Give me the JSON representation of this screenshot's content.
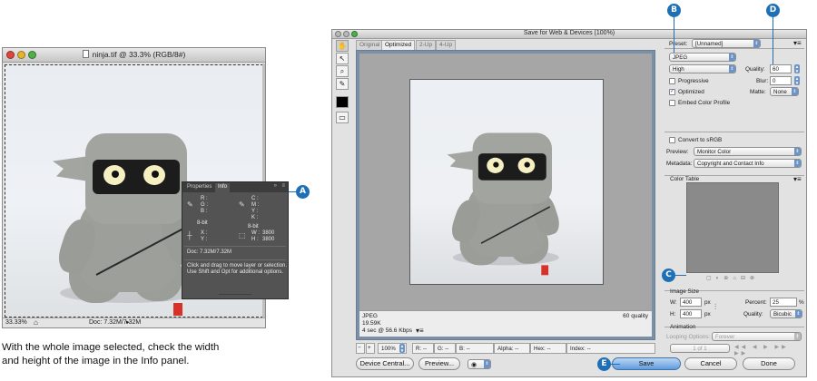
{
  "doc_window": {
    "title": "ninja.tif @ 33.3% (RGB/8#)",
    "zoom": "33.33%",
    "doc_size": "Doc: 7.32M/7.32M"
  },
  "info_panel": {
    "tabs": [
      "Properties",
      "Info"
    ],
    "rgb_letters": [
      "R :",
      "G :",
      "B :"
    ],
    "cmyk_letters": [
      "C :",
      "M :",
      "Y :",
      "K :"
    ],
    "bitdepth_left": "8-bit",
    "bitdepth_right": "8-bit",
    "xy_letters": [
      "X :",
      "Y :"
    ],
    "w_label": "W :",
    "h_label": "H :",
    "w_value": "3800",
    "h_value": "3800",
    "doc": "Doc: 7.32M/7.32M",
    "hint_line1": "Click and drag to move layer or selection.",
    "hint_line2": "Use Shift and Opt for additional options."
  },
  "callouts": {
    "a": "A",
    "b": "B",
    "c": "C",
    "d": "D",
    "e": "E"
  },
  "caption": {
    "line1": "With the whole image selected, check the width",
    "line2": "and height of the image in the Info panel."
  },
  "dialog": {
    "title": "Save for Web & Devices (100%)",
    "tabs": [
      "Original",
      "Optimized",
      "2-Up",
      "4-Up"
    ],
    "active_tab": "Optimized",
    "preview_info": {
      "format": "JPEG",
      "size": "19.59K",
      "time": "4 sec @ 56.6 Kbps",
      "quality": "60 quality"
    },
    "statusbar": {
      "zoom": "100%",
      "r": "R: --",
      "g": "G: --",
      "b": "B: --",
      "alpha": "Alpha: --",
      "hex": "Hex: --",
      "index": "Index: --"
    },
    "buttons": {
      "device_central": "Device Central...",
      "preview": "Preview...",
      "save": "Save",
      "cancel": "Cancel",
      "done": "Done"
    },
    "settings": {
      "preset_label": "Preset:",
      "preset_value": "[Unnamed]",
      "format": "JPEG",
      "quality_level": "High",
      "quality_label": "Quality:",
      "quality_value": "60",
      "progressive": "Progressive",
      "blur_label": "Blur:",
      "blur_value": "0",
      "optimized": "Optimized",
      "optimized_checked": true,
      "matte_label": "Matte:",
      "matte_value": "None",
      "embed_profile": "Embed Color Profile",
      "convert_srgb": "Convert to sRGB",
      "preview_label": "Preview:",
      "preview_value": "Monitor Color",
      "metadata_label": "Metadata:",
      "metadata_value": "Copyright and Contact Info",
      "color_table": "Color Table",
      "image_size": "Image Size",
      "w_label": "W:",
      "w_value": "400",
      "h_label": "H:",
      "h_value": "400",
      "unit": "px",
      "percent_label": "Percent:",
      "percent_value": "25",
      "percent_sign": "%",
      "quality2_label": "Quality:",
      "quality2_value": "Bicubic",
      "animation": "Animation",
      "looping_label": "Looping Options:",
      "looping_value": "Forever",
      "frame_counter": "1 of 1"
    }
  }
}
